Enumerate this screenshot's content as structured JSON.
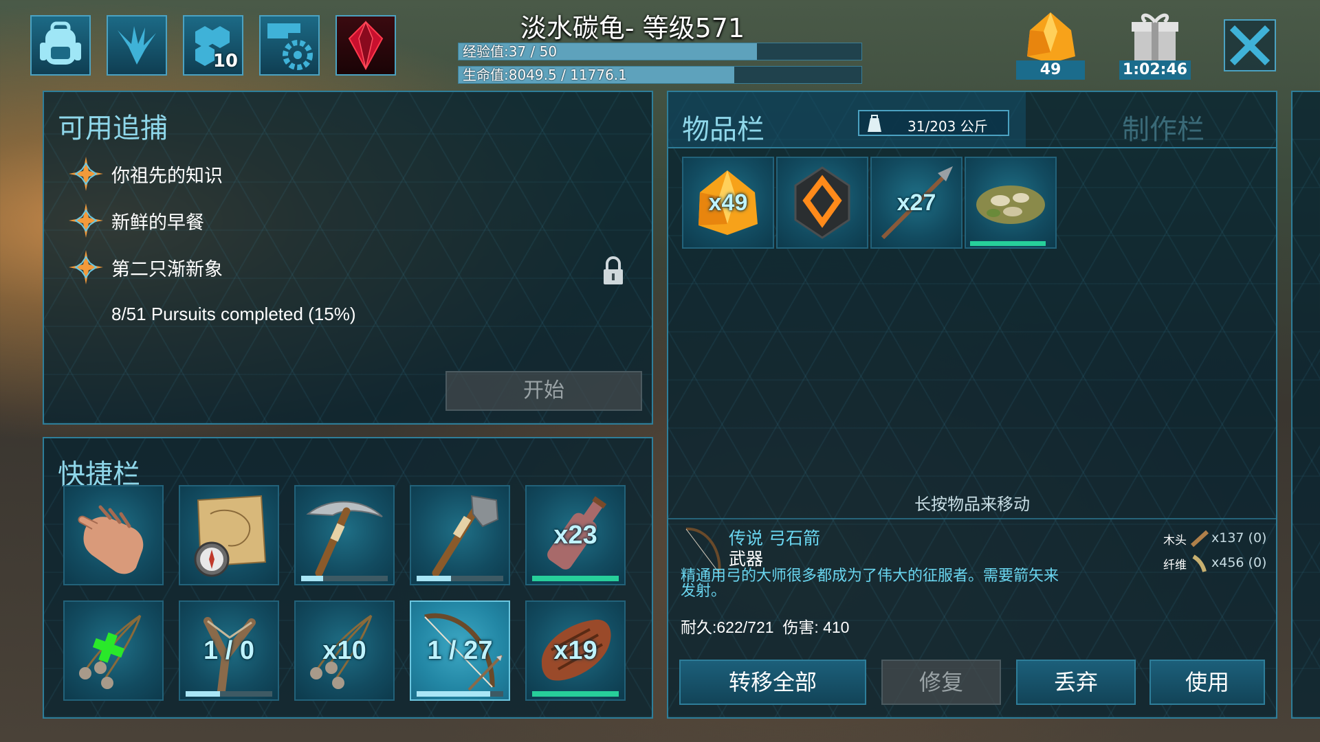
{
  "header": {
    "title": "淡水碳龟- 等级571",
    "xp_text": "经验值:37 / 50",
    "xp_fraction": 0.74,
    "hp_text": "生命值:8049.5 / 11776.1",
    "hp_fraction": 0.684,
    "engram_badge": "10",
    "amber_count": "49",
    "gift_timer": "1:02:46"
  },
  "pursuits": {
    "title": "可用追捕",
    "items": [
      {
        "label": "你祖先的知识"
      },
      {
        "label": "新鲜的早餐"
      },
      {
        "label": "第二只渐新象"
      }
    ],
    "progress": "8/51 Pursuits completed (15%)",
    "start_label": "开始"
  },
  "hotbar": {
    "title": "快捷栏",
    "slots": [
      {
        "icon": "hand-icon",
        "qty": "",
        "durability": null
      },
      {
        "icon": "map-compass-icon",
        "qty": "",
        "durability": null
      },
      {
        "icon": "stone-pick-icon",
        "qty": "",
        "durability": 0.25
      },
      {
        "icon": "stone-hatchet-icon",
        "qty": "",
        "durability": 0.4
      },
      {
        "icon": "water-bottle-icon",
        "qty": "x23",
        "durability": 1.0
      },
      {
        "icon": "bola-green-icon",
        "qty": "",
        "durability": null
      },
      {
        "icon": "slingshot-icon",
        "qty": "1 / 0",
        "durability": 0.4
      },
      {
        "icon": "bola-icon",
        "qty": "x10",
        "durability": null
      },
      {
        "icon": "bow-icon",
        "qty": "1 / 27",
        "durability": 0.85
      },
      {
        "icon": "cooked-meat-icon",
        "qty": "x19",
        "durability": 1.0
      }
    ]
  },
  "inventory": {
    "title": "物品栏",
    "weight": "31/203 公斤",
    "craft_tab": "制作栏",
    "slots": [
      {
        "icon": "amber-icon",
        "qty": "x49"
      },
      {
        "icon": "emblem-icon",
        "qty": ""
      },
      {
        "icon": "stone-arrow-icon",
        "qty": "x27"
      },
      {
        "icon": "kibble-icon",
        "qty": "",
        "durability": 1.0
      }
    ],
    "hint": "长按物品来移动"
  },
  "item_detail": {
    "name": "传说 弓石箭",
    "type": "武器",
    "description": "精通用弓的大师很多都成为了伟大的征服者。需要箭矢来发射。",
    "durability_label": "耐久:",
    "durability_value": "622/721",
    "damage_label": "伤害:",
    "damage_value": "410",
    "materials": [
      {
        "name": "木头",
        "amount": "x137 (0)"
      },
      {
        "name": "纤维",
        "amount": "x456 (0)"
      }
    ]
  },
  "actions": {
    "transfer_all": "转移全部",
    "repair": "修复",
    "drop": "丢弃",
    "use": "使用"
  },
  "colors": {
    "accent": "#8fd7ea",
    "panel_border": "#2e7e9a",
    "durability_green": "#27cf9a"
  }
}
